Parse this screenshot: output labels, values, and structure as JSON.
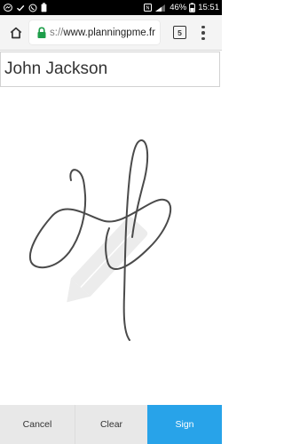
{
  "status_bar": {
    "battery_percent": "46%",
    "time": "15:51",
    "left_icons": [
      "messenger-icon",
      "check-icon",
      "whatsapp-icon",
      "battery-saver-icon"
    ],
    "right_icons": [
      "nfc-icon",
      "signal-icon",
      "battery-icon"
    ]
  },
  "browser": {
    "url_scheme": "s://",
    "url_host": "www.planningpme.fr",
    "tab_count": "5"
  },
  "form": {
    "name": "John Jackson"
  },
  "signature": {
    "watermark_icon": "pencil-icon"
  },
  "actions": {
    "cancel": "Cancel",
    "clear": "Clear",
    "sign": "Sign"
  },
  "colors": {
    "sign_button": "#28a3e9",
    "lock": "#1e9e4a",
    "ink": "#4a4a4a"
  }
}
